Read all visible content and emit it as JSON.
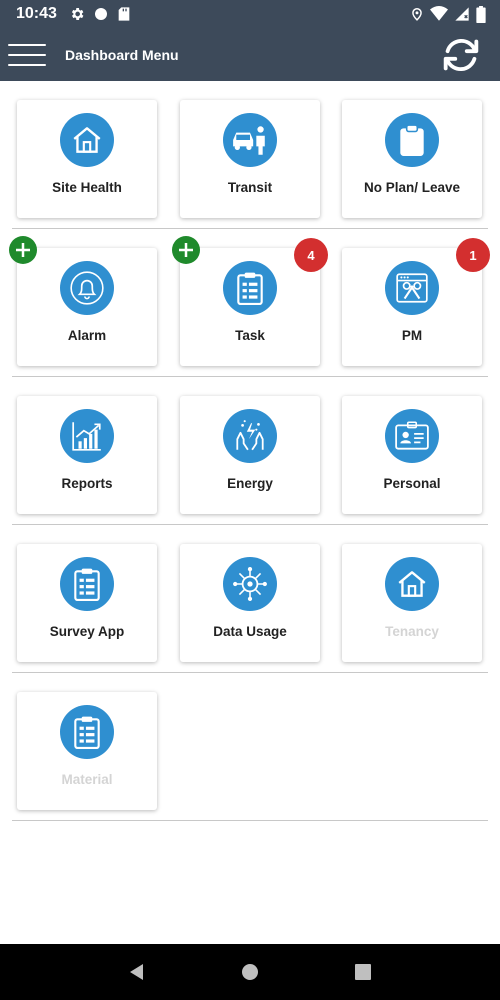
{
  "status_bar": {
    "time": "10:43",
    "left_icons": [
      "gear-icon",
      "circle-icon",
      "sd-card-icon"
    ],
    "right_icons": [
      "location-icon",
      "wifi-icon",
      "signal-icon",
      "battery-icon"
    ]
  },
  "app_bar": {
    "title": "Dashboard Menu",
    "menu_icon": "hamburger-menu-icon",
    "sync_icon": "sync-icon"
  },
  "colors": {
    "header": "#3d4a5a",
    "icon_circle": "#2f8fd0",
    "add_badge": "#1f8a2c",
    "count_badge": "#d32f2f",
    "disabled_label": "#d4d4d4"
  },
  "tiles": [
    {
      "label": "Site Health",
      "icon": "house-icon"
    },
    {
      "label": "Transit",
      "icon": "car-person-icon"
    },
    {
      "label": "No Plan/ Leave",
      "icon": "clipboard-icon"
    },
    {
      "label": "Alarm",
      "icon": "bell-icon",
      "add": true
    },
    {
      "label": "Task",
      "icon": "task-list-icon",
      "add": true,
      "count": "4"
    },
    {
      "label": "PM",
      "icon": "maintenance-tools-icon",
      "count": "1"
    },
    {
      "label": "Reports",
      "icon": "growth-chart-icon"
    },
    {
      "label": "Energy",
      "icon": "hands-energy-icon"
    },
    {
      "label": "Personal",
      "icon": "id-card-icon"
    },
    {
      "label": "Survey App",
      "icon": "survey-clipboard-icon"
    },
    {
      "label": "Data Usage",
      "icon": "data-network-icon"
    },
    {
      "label": "Tenancy",
      "icon": "house-icon",
      "disabled": true
    },
    {
      "label": "Material",
      "icon": "material-clipboard-icon",
      "disabled": true
    }
  ],
  "nav_bar": {
    "back_icon": "back-triangle-icon",
    "home_icon": "home-circle-icon",
    "recents_icon": "recents-square-icon"
  }
}
